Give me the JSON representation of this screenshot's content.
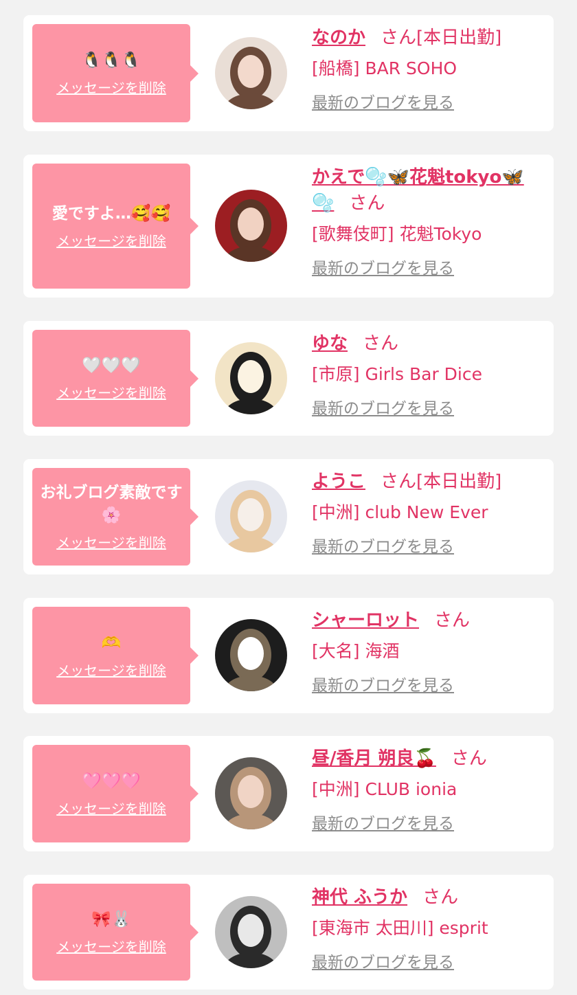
{
  "items": [
    {
      "message": "🐧🐧🐧",
      "delete_label": "メッセージを削除",
      "name": "なのか",
      "san": "さん",
      "status": "[本日出勤]",
      "shop": "[船橋] BAR SOHO",
      "blog_label": "最新のブログを見る"
    },
    {
      "message": "愛ですよ…🥰🥰",
      "delete_label": "メッセージを削除",
      "name": "かえで🫧🦋花魁tokyo🦋🫧",
      "san": "さん",
      "status": "",
      "shop": "[歌舞伎町] 花魁Tokyo",
      "blog_label": "最新のブログを見る"
    },
    {
      "message": "🤍🤍🤍",
      "delete_label": "メッセージを削除",
      "name": "ゆな",
      "san": "さん",
      "status": "",
      "shop": "[市原] Girls Bar Dice",
      "blog_label": "最新のブログを見る"
    },
    {
      "message": "お礼ブログ素敵です🌸",
      "delete_label": "メッセージを削除",
      "name": "ようこ",
      "san": "さん",
      "status": "[本日出勤]",
      "shop": "[中洲] club New Ever",
      "blog_label": "最新のブログを見る"
    },
    {
      "message": "🫶",
      "delete_label": "メッセージを削除",
      "name": "シャーロット",
      "san": "さん",
      "status": "",
      "shop": "[大名] 海酒",
      "blog_label": "最新のブログを見る"
    },
    {
      "message": "🩷🩷🩷",
      "delete_label": "メッセージを削除",
      "name": "昼/香月 朔良🍒",
      "san": "さん",
      "status": "",
      "shop": "[中洲] CLUB ionia",
      "blog_label": "最新のブログを見る"
    },
    {
      "message": "🎀🐰",
      "delete_label": "メッセージを削除",
      "name": "神代 ふうか",
      "san": "さん",
      "status": "",
      "shop": "[東海市 太田川] esprit",
      "blog_label": "最新のブログを見る"
    }
  ],
  "colors": {
    "background": "#f2f2f2",
    "card": "#ffffff",
    "bubble": "#fd95a5",
    "accent": "#e13364",
    "link_gray": "#8c8c8c"
  },
  "avatar_palettes": [
    [
      "#e9ded6",
      "#6b4a3a",
      "#f3d9cc"
    ],
    [
      "#9c1e22",
      "#5a3526",
      "#f1d2c2"
    ],
    [
      "#f2e4c6",
      "#1e1e1e",
      "#fbf3e2"
    ],
    [
      "#e6e8ef",
      "#e8c8a0",
      "#f6efe9"
    ],
    [
      "#1d1d1d",
      "#7a6a55",
      "#ffffff"
    ],
    [
      "#5c5854",
      "#b89679",
      "#f0d4c5"
    ],
    [
      "#bfbfbf",
      "#2a2a2a",
      "#e8e8e8"
    ]
  ]
}
